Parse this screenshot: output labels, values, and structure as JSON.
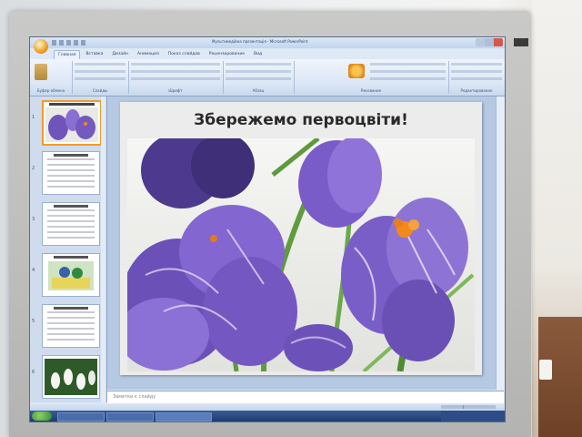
{
  "window": {
    "title": "Мультимедійна презентація - Microsoft PowerPoint"
  },
  "ribbon": {
    "tabs": [
      "Главная",
      "Вставка",
      "Дизайн",
      "Анимация",
      "Показ слайдов",
      "Рецензирование",
      "Вид"
    ],
    "groups": [
      "Буфер обмена",
      "Слайды",
      "Шрифт",
      "Абзац",
      "Рисование",
      "Редактирование"
    ],
    "active_tab": "Главная"
  },
  "slides_pane": {
    "selected_index": 1,
    "thumbnails": [
      {
        "number": "1",
        "kind": "photo",
        "title": "Збережемо первоцвіти!"
      },
      {
        "number": "2",
        "kind": "text"
      },
      {
        "number": "3",
        "kind": "text"
      },
      {
        "number": "4",
        "kind": "photo"
      },
      {
        "number": "5",
        "kind": "text"
      },
      {
        "number": "6",
        "kind": "photo"
      }
    ]
  },
  "slide": {
    "title": "Збережемо первоцвіти!",
    "photo_subject": "purple striped crocus flowers"
  },
  "notes": {
    "placeholder": "Заметки к слайду"
  },
  "colors": {
    "accent_orange": "#f29b2a",
    "ribbon_blue": "#dbe6f5",
    "crocus_purple": "#7a5cc9"
  }
}
